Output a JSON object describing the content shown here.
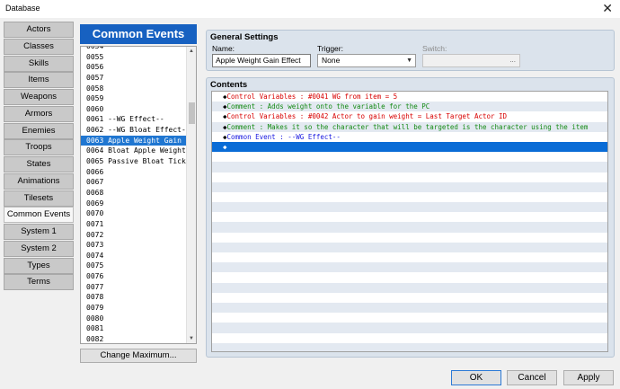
{
  "window": {
    "title": "Database",
    "close_glyph": "✕"
  },
  "sidebar": {
    "items": [
      {
        "label": "Actors"
      },
      {
        "label": "Classes"
      },
      {
        "label": "Skills"
      },
      {
        "label": "Items"
      },
      {
        "label": "Weapons"
      },
      {
        "label": "Armors"
      },
      {
        "label": "Enemies"
      },
      {
        "label": "Troops"
      },
      {
        "label": "States"
      },
      {
        "label": "Animations"
      },
      {
        "label": "Tilesets"
      },
      {
        "label": "Common Events"
      },
      {
        "label": "System 1"
      },
      {
        "label": "System 2"
      },
      {
        "label": "Types"
      },
      {
        "label": "Terms"
      }
    ],
    "active_index": 11
  },
  "list": {
    "header": "Common Events",
    "rows": [
      "0054",
      "0055",
      "0056",
      "0057",
      "0058",
      "0059",
      "0060",
      "0061 --WG Effect--",
      "0062 --WG Bloat Effect--",
      "0063 Apple Weight Gain E…",
      "0064 Bloat Apple Weight …",
      "0065 Passive Bloat Ticker",
      "0066",
      "0067",
      "0068",
      "0069",
      "0070",
      "0071",
      "0072",
      "0073",
      "0074",
      "0075",
      "0076",
      "0077",
      "0078",
      "0079",
      "0080",
      "0081",
      "0082"
    ],
    "selected_index": 9,
    "change_max_label": "Change Maximum..."
  },
  "general_settings": {
    "title": "General Settings",
    "name_label": "Name:",
    "name_value": "Apple Weight Gain Effect",
    "trigger_label": "Trigger:",
    "trigger_value": "None",
    "switch_label": "Switch:",
    "switch_button": "..."
  },
  "contents": {
    "title": "Contents",
    "commands": [
      {
        "marker": "◆",
        "text": "Control Variables : #0041 WG from item = 5",
        "color": "#d80000"
      },
      {
        "marker": "◆",
        "text": "Comment : Adds weight onto the variable for the PC",
        "color": "#148a14"
      },
      {
        "marker": "◆",
        "text": "Control Variables : #0042 Actor to gain weight = Last Target Actor ID",
        "color": "#d80000"
      },
      {
        "marker": "◆",
        "text": "Comment : Makes it so the character that will be targeted is the character using the item",
        "color": "#148a14"
      },
      {
        "marker": "◆",
        "text": "Common Event : --WG Effect--",
        "color": "#1818e0"
      },
      {
        "marker": "◆",
        "text": "",
        "color": "#ffffff"
      }
    ],
    "selected_index": 5
  },
  "buttons": {
    "ok": "OK",
    "cancel": "Cancel",
    "apply": "Apply"
  },
  "colors": {
    "accent": "#1761c1",
    "selection": "#1f76d1",
    "panel_bg": "#dbe3ec"
  }
}
